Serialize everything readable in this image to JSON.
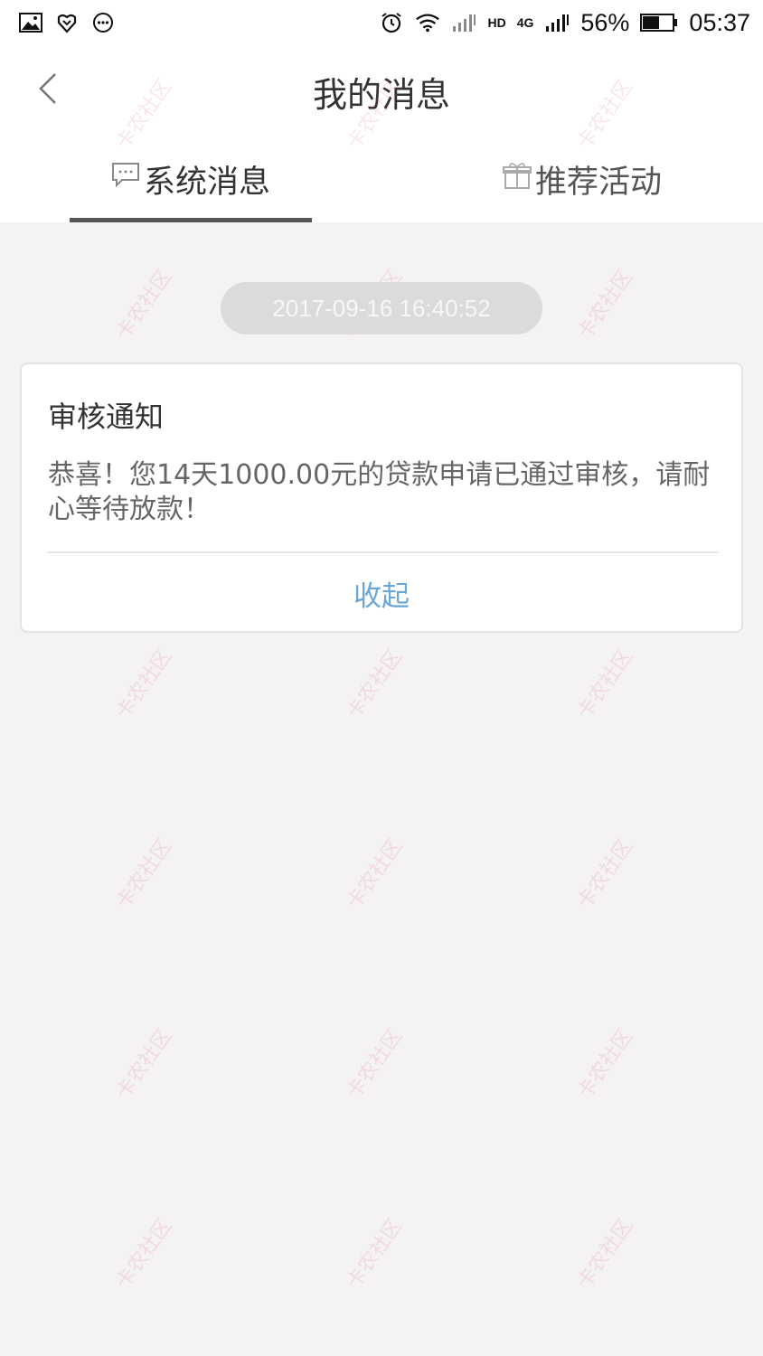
{
  "status_bar": {
    "battery_percent": "56%",
    "time": "05:37",
    "network_label": "4G",
    "hd_label": "HD"
  },
  "header": {
    "title": "我的消息"
  },
  "tabs": {
    "system_label": "系统消息",
    "activity_label": "推荐活动",
    "active": "system"
  },
  "message": {
    "timestamp": "2017-09-16 16:40:52",
    "title": "审核通知",
    "body": "恭喜！您14天1000.00元的贷款申请已通过审核，请耐心等待放款！",
    "collapse_label": "收起"
  },
  "watermark_text": "卡农社区",
  "colors": {
    "background": "#f4f2f3",
    "link": "#6aa6d6",
    "tab_active_underline": "#555555"
  },
  "icons": {
    "back": "chevron-left-icon",
    "system_tab": "chat-bubble-icon",
    "activity_tab": "gift-icon"
  }
}
